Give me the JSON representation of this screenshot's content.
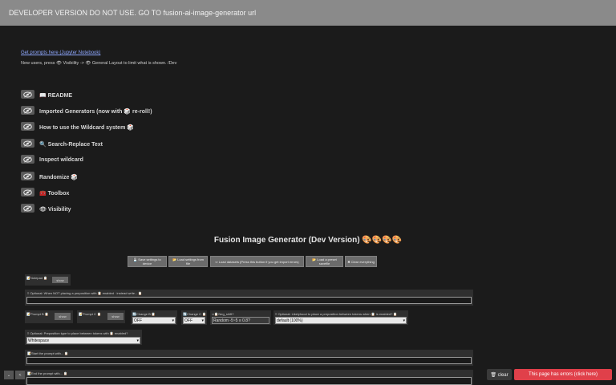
{
  "banner": "DEVELOPER VERSION DO NOT USE. GO TO fusion-ai-image-generator url",
  "prompts_link": "Get prompts here (Jupyter Notebook)",
  "new_users_hint": "New users, press 👁 Visibility -> 👁 General Layout to limit what is shown. /Dev",
  "sections": [
    {
      "label": "📖 README"
    },
    {
      "label": "Imported Generators (now with 🎲 re-roll!)"
    },
    {
      "label": "How to use the Wildcard system 🎲"
    },
    {
      "label": "🔍 Search-Replace Text"
    },
    {
      "label": "Inspect wildcard"
    },
    {
      "label": "Randomize 🎲"
    },
    {
      "label": "🧰 Toolbox"
    },
    {
      "label": "👁 Visibility"
    }
  ],
  "title": "Fusion Image Generator (Dev Version) 🎨🎨🎨🎨",
  "toolbar": {
    "save": "💾 Save settings to device",
    "load": "📂 Load settings from file",
    "dataset": "⇨ Load datasets (Press this button if you get import errors)",
    "preset": "📂 Load a preset savefile",
    "clear": "✖ Clear everything"
  },
  "fields": {
    "notepad_label": "📝Notepad 📋",
    "show": "show",
    "optional_not_placing": "≡ Optional: When NOT placing a preposition with 📋 enabled · instead write... 📋",
    "prompt_b_label": "📝Prompt B 📋",
    "prompt_c_label": "📝Prompt C 📋",
    "change_b_label": "🔄Change B 📋",
    "change_b_value": "OFF",
    "change_c_label": "🔄Change C 📋",
    "change_c_value": "OFF",
    "neg_shift_label": "⇨📋Neg_shift?",
    "neg_shift_value": "Random -5~5 ≡ 0.8?",
    "likelyhood_label": "≡ Optional: Likelyhood to place a preposition between tokens when 📋 is enabled? 📋",
    "likelyhood_value": "default (100%)",
    "preposition_type_label": "≡ Optional: Preposition type to place between tokens with 📋 enabled?",
    "preposition_type_value": "Whitespace",
    "start_label": "📝Start the prompt with... 📋",
    "end_label": "📝End the prompt with... 📋"
  },
  "bottom": {
    "clear": "🗑 clear",
    "errors": "This page has errors (click here)",
    "btn_a": "⌄",
    "btn_b": "<"
  },
  "colors": {
    "background": "#1b1b1b",
    "banner": "#8a8a8a",
    "error": "#e0404a"
  }
}
